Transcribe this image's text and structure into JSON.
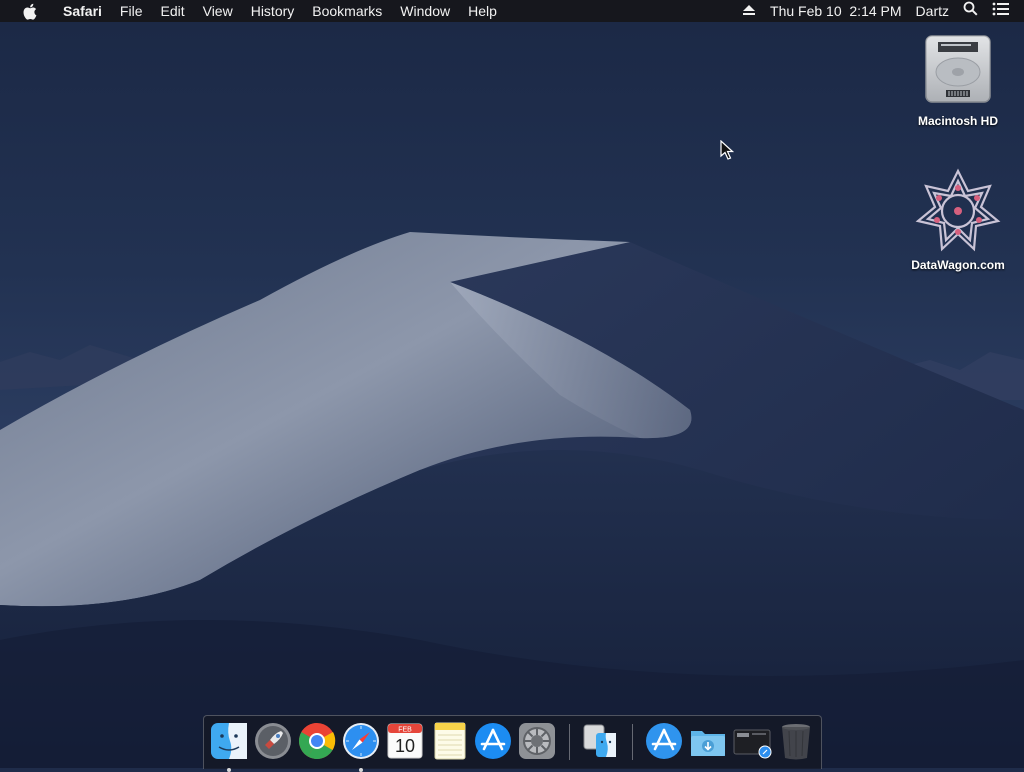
{
  "menubar": {
    "apple_icon": "apple-logo-icon",
    "app_name": "Safari",
    "menus": [
      "File",
      "Edit",
      "View",
      "History",
      "Bookmarks",
      "Window",
      "Help"
    ],
    "eject_icon": "eject-icon",
    "clock": "Thu Feb 10  2:14 PM",
    "user": "Dartz",
    "spotlight_icon": "search-icon",
    "notification_icon": "list-icon"
  },
  "desktop": {
    "icons": [
      {
        "label": "Macintosh HD",
        "icon": "hard-drive-icon"
      },
      {
        "label": "DataWagon.com",
        "icon": "network-volume-icon"
      }
    ]
  },
  "dock": {
    "items": [
      {
        "name": "Finder",
        "icon": "finder-icon",
        "running": true
      },
      {
        "name": "Launchpad",
        "icon": "launchpad-icon",
        "running": false
      },
      {
        "name": "Google Chrome",
        "icon": "chrome-icon",
        "running": false
      },
      {
        "name": "Safari",
        "icon": "safari-icon",
        "running": true
      },
      {
        "name": "Calendar",
        "icon": "calendar-icon",
        "running": false,
        "month": "FEB",
        "day": "10"
      },
      {
        "name": "Notes",
        "icon": "notes-icon",
        "running": false
      },
      {
        "name": "App Store",
        "icon": "app-store-icon",
        "running": false
      },
      {
        "name": "System Preferences",
        "icon": "gear-icon",
        "running": false
      },
      {
        "name": "Migration Assistant",
        "icon": "migration-assistant-icon",
        "running": false
      },
      {
        "name": "Applications",
        "icon": "applications-folder-icon",
        "running": false
      },
      {
        "name": "Downloads",
        "icon": "downloads-folder-icon",
        "running": false
      },
      {
        "name": "Screenshot",
        "icon": "screenshot-stack-icon",
        "running": false
      },
      {
        "name": "Trash",
        "icon": "trash-icon",
        "running": false
      }
    ]
  },
  "colors": {
    "menubar_bg": "#16161a",
    "sky_top": "#1b2845",
    "dune_light": "#9aa3b5",
    "dune_dark": "#1e2a48"
  }
}
